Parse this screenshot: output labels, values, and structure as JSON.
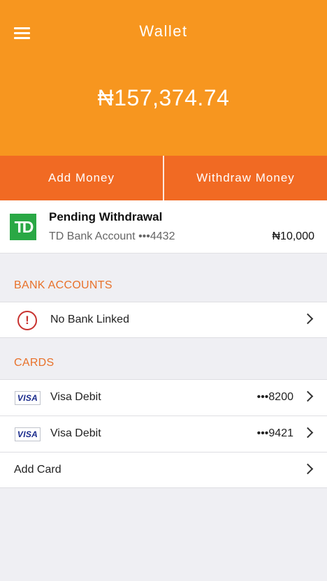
{
  "header": {
    "title": "Wallet",
    "balance": "₦157,374.74"
  },
  "actions": {
    "add_money": "Add Money",
    "withdraw_money": "Withdraw Money"
  },
  "pending": {
    "title": "Pending Withdrawal",
    "account": "TD Bank Account •••4432",
    "amount": "₦10,000",
    "logo_text": "TD"
  },
  "bank_accounts": {
    "label": "BANK ACCOUNTS",
    "items": [
      {
        "label": "No Bank Linked",
        "icon": "alert-circle-icon"
      }
    ]
  },
  "cards": {
    "label": "CARDS",
    "items": [
      {
        "label": "Visa Debit",
        "number": "•••8200",
        "brand": "VISA"
      },
      {
        "label": "Visa Debit",
        "number": "•••9421",
        "brand": "VISA"
      }
    ],
    "add_card": "Add Card"
  },
  "colors": {
    "header_bg": "#f7961f",
    "actions_bg": "#f16a23",
    "section_label": "#e8712a",
    "td_green": "#2aa845",
    "alert_red": "#c8322f"
  }
}
